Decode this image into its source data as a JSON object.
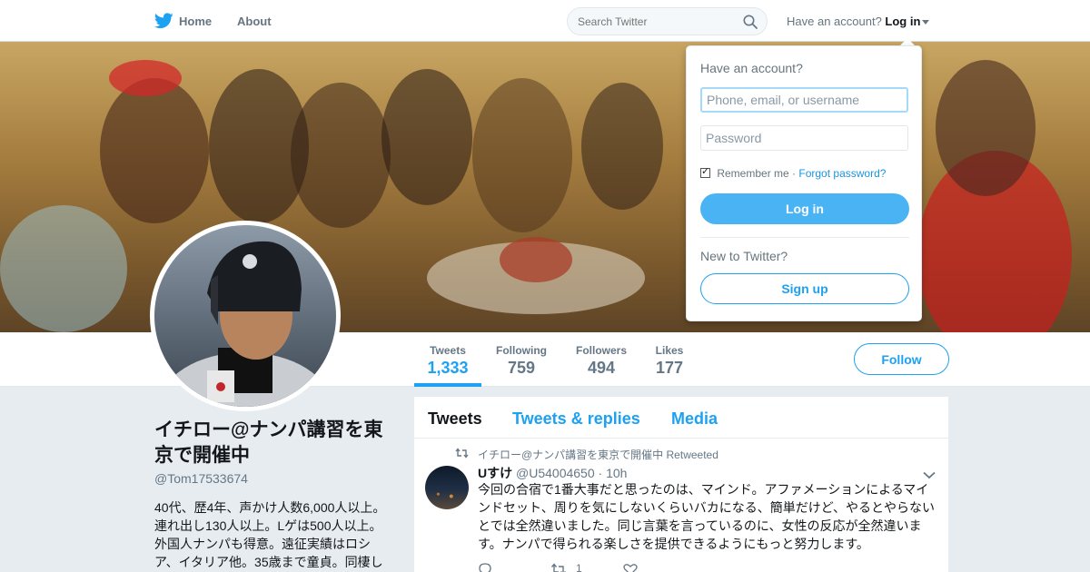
{
  "nav": {
    "home_label": "Home",
    "about_label": "About",
    "search_placeholder": "Search Twitter",
    "have_account": "Have an account?",
    "login_label": "Log in"
  },
  "profile": {
    "name": "イチロー@ナンパ講習を東京で開催中",
    "handle": "@Tom17533674",
    "bio": "40代、歴4年、声かけ人数6,000人以上。連れ出し130人以上。Lゲは500人以上。外国人ナンパも得意。遠征実績はロシア、イタリア他。35歳まで童貞。同棲し",
    "follow_label": "Follow"
  },
  "stats": [
    {
      "label": "Tweets",
      "value": "1,333",
      "active": true
    },
    {
      "label": "Following",
      "value": "759"
    },
    {
      "label": "Followers",
      "value": "494"
    },
    {
      "label": "Likes",
      "value": "177"
    }
  ],
  "timeline": {
    "tabs": [
      "Tweets",
      "Tweets & replies",
      "Media"
    ],
    "tweet": {
      "retweeted_by": "イチロー@ナンパ講習を東京で開催中 Retweeted",
      "user": "Uすけ",
      "handle": "@U54004650",
      "time": "· 10h",
      "text": "今回の合宿で1番大事だと思ったのは、マインド。アファメーションによるマインドセット、周りを気にしないくらいバカになる、簡単だけど、やるとやらないとでは全然違いました。同じ言葉を言っているのに、女性の反応が全然違います。ナンパで得られる楽しさを提供できるようにもっと努力します。",
      "retweet_count": "1"
    }
  },
  "login_dropdown": {
    "title": "Have an account?",
    "username_placeholder": "Phone, email, or username",
    "password_placeholder": "Password",
    "remember_label": "Remember me ·",
    "forgot_label": "Forgot password?",
    "login_button": "Log in",
    "new_to_twitter": "New to Twitter?",
    "signup_button": "Sign up"
  },
  "colors": {
    "accent": "#1da1f2",
    "login_button": "#4ab3f4",
    "background": "#e6ecf0"
  }
}
